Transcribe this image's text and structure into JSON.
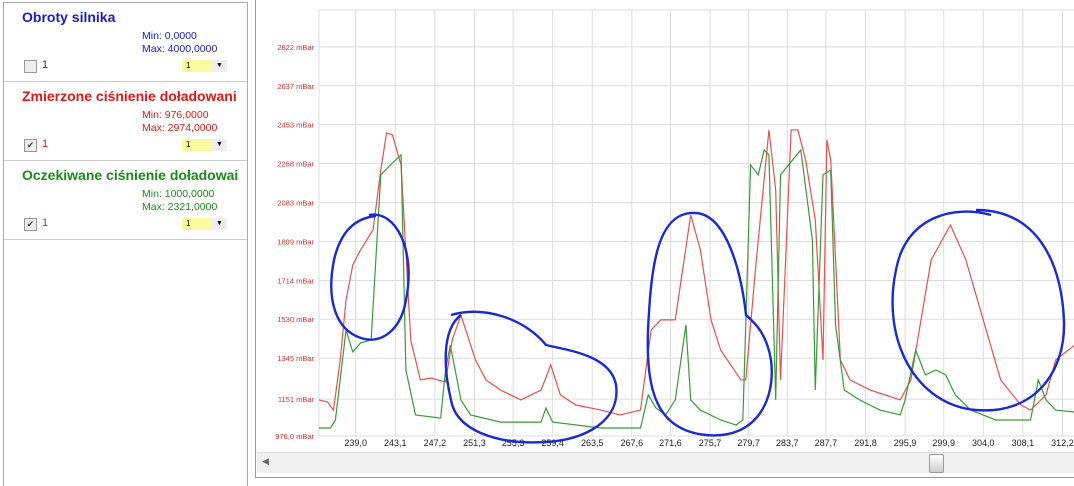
{
  "series_panel": [
    {
      "title": "Obroty silnika",
      "min": "Min: 0,0000",
      "max": "Max: 4000,0000",
      "checked": false,
      "check_label": "1",
      "select_value": "1",
      "color": "#1a1acc"
    },
    {
      "title": "Zmierzone ciśnienie doładowani",
      "min": "Min: 976,0000",
      "max": "Max: 2974,0000",
      "checked": true,
      "check_label": "1",
      "select_value": "1",
      "color": "#e01818"
    },
    {
      "title": "Oczekiwane ciśnienie doładowai",
      "min": "Min: 1000,0000",
      "max": "Max: 2321,0000",
      "checked": true,
      "check_label": "1",
      "select_value": "1",
      "color": "#1a8a1a"
    }
  ],
  "chart_data": {
    "type": "line",
    "xlim": [
      235.2,
      313.5
    ],
    "ylim": [
      976,
      2997
    ],
    "x_ticks": [
      "239,0",
      "243,1",
      "247,2",
      "251,3",
      "255,3",
      "259,4",
      "263,5",
      "267,6",
      "271,6",
      "275,7",
      "279,7",
      "283,7",
      "287,7",
      "291,8",
      "295,9",
      "299,9",
      "304,0",
      "308,1",
      "312,2"
    ],
    "x_tick_values": [
      239.0,
      243.1,
      247.2,
      251.3,
      255.3,
      259.4,
      263.5,
      267.6,
      271.6,
      275.7,
      279.7,
      283.7,
      287.7,
      291.8,
      295.9,
      299.9,
      304.0,
      308.1,
      312.2
    ],
    "y_ticks": [
      "976,0 mBar",
      "1151 mBar",
      "1345 mBar",
      "1530 mBar",
      "1714 mBar",
      "1899 mBar",
      "2083 mBar",
      "2268 mBar",
      "2453 mBar",
      "2637 mBar",
      "2822 mBar"
    ],
    "y_tick_values": [
      976,
      1151,
      1345,
      1530,
      1714,
      1899,
      2083,
      2268,
      2453,
      2637,
      2822
    ],
    "grid": true,
    "series": [
      {
        "name": "Zmierzone ciśnienie doładowania",
        "color": "#e85050",
        "points": [
          [
            235.2,
            1147
          ],
          [
            236.1,
            1137
          ],
          [
            236.7,
            1099
          ],
          [
            237.4,
            1337
          ],
          [
            238.0,
            1621
          ],
          [
            238.7,
            1788
          ],
          [
            239.5,
            1859
          ],
          [
            240.8,
            1954
          ],
          [
            241.6,
            2238
          ],
          [
            242.2,
            2414
          ],
          [
            242.8,
            2405
          ],
          [
            243.7,
            2262
          ],
          [
            244.7,
            1432
          ],
          [
            245.7,
            1242
          ],
          [
            246.8,
            1251
          ],
          [
            248.3,
            1232
          ],
          [
            249.0,
            1432
          ],
          [
            249.9,
            1550
          ],
          [
            250.4,
            1479
          ],
          [
            251.4,
            1337
          ],
          [
            252.5,
            1242
          ],
          [
            254.0,
            1194
          ],
          [
            256.1,
            1147
          ],
          [
            258.2,
            1194
          ],
          [
            259.2,
            1313
          ],
          [
            260.2,
            1171
          ],
          [
            261.8,
            1123
          ],
          [
            264.4,
            1099
          ],
          [
            266.4,
            1076
          ],
          [
            268.5,
            1099
          ],
          [
            269.6,
            1479
          ],
          [
            270.6,
            1527
          ],
          [
            272.1,
            1527
          ],
          [
            273.7,
            2025
          ],
          [
            274.7,
            1859
          ],
          [
            275.8,
            1527
          ],
          [
            276.8,
            1384
          ],
          [
            278.9,
            1242
          ],
          [
            279.4,
            1242
          ],
          [
            280.4,
            1764
          ],
          [
            281.2,
            2144
          ],
          [
            281.8,
            2428
          ],
          [
            282.5,
            2144
          ],
          [
            283.0,
            1242
          ],
          [
            284.1,
            2428
          ],
          [
            284.8,
            2428
          ],
          [
            285.6,
            2286
          ],
          [
            286.6,
            2001
          ],
          [
            287.4,
            1337
          ],
          [
            287.8,
            2381
          ],
          [
            288.2,
            2286
          ],
          [
            289.2,
            1337
          ],
          [
            290.2,
            1242
          ],
          [
            292.3,
            1194
          ],
          [
            295.4,
            1147
          ],
          [
            296.5,
            1242
          ],
          [
            298.6,
            1811
          ],
          [
            300.6,
            1977
          ],
          [
            302.2,
            1811
          ],
          [
            304.3,
            1479
          ],
          [
            305.8,
            1242
          ],
          [
            307.9,
            1123
          ],
          [
            308.9,
            1099
          ],
          [
            310.5,
            1171
          ],
          [
            311.5,
            1337
          ],
          [
            313.5,
            1408
          ]
        ]
      },
      {
        "name": "Oczekiwane ciśnienie doładowania",
        "color": "#3a9a3a",
        "points": [
          [
            235.2,
            1014
          ],
          [
            236.4,
            1014
          ],
          [
            236.9,
            1052
          ],
          [
            238.0,
            1479
          ],
          [
            238.7,
            1375
          ],
          [
            239.5,
            1417
          ],
          [
            240.6,
            1432
          ],
          [
            241.6,
            2215
          ],
          [
            242.6,
            2262
          ],
          [
            243.7,
            2310
          ],
          [
            244.2,
            1289
          ],
          [
            245.2,
            1076
          ],
          [
            247.8,
            1061
          ],
          [
            248.3,
            1289
          ],
          [
            248.8,
            1408
          ],
          [
            249.9,
            1147
          ],
          [
            250.9,
            1076
          ],
          [
            254.0,
            1042
          ],
          [
            258.2,
            1042
          ],
          [
            258.7,
            1109
          ],
          [
            259.4,
            1042
          ],
          [
            264.4,
            1014
          ],
          [
            268.5,
            1014
          ],
          [
            269.3,
            1171
          ],
          [
            270.1,
            1109
          ],
          [
            271.1,
            1076
          ],
          [
            272.1,
            1147
          ],
          [
            273.2,
            1503
          ],
          [
            273.7,
            1147
          ],
          [
            274.7,
            1099
          ],
          [
            276.8,
            1052
          ],
          [
            278.4,
            1028
          ],
          [
            279.1,
            1052
          ],
          [
            279.9,
            2262
          ],
          [
            280.7,
            2215
          ],
          [
            281.3,
            2333
          ],
          [
            281.8,
            2310
          ],
          [
            282.5,
            1147
          ],
          [
            283.0,
            2215
          ],
          [
            285.1,
            2333
          ],
          [
            286.3,
            1906
          ],
          [
            286.6,
            1194
          ],
          [
            287.4,
            2215
          ],
          [
            288.2,
            2238
          ],
          [
            288.7,
            1503
          ],
          [
            289.6,
            1194
          ],
          [
            291.2,
            1147
          ],
          [
            293.3,
            1099
          ],
          [
            295.4,
            1076
          ],
          [
            295.9,
            1147
          ],
          [
            297.0,
            1384
          ],
          [
            298.0,
            1266
          ],
          [
            299.1,
            1289
          ],
          [
            300.1,
            1266
          ],
          [
            301.1,
            1171
          ],
          [
            302.7,
            1099
          ],
          [
            305.3,
            1052
          ],
          [
            308.9,
            1052
          ],
          [
            309.7,
            1242
          ],
          [
            310.5,
            1147
          ],
          [
            311.5,
            1099
          ],
          [
            313.5,
            1090
          ]
        ]
      }
    ]
  }
}
